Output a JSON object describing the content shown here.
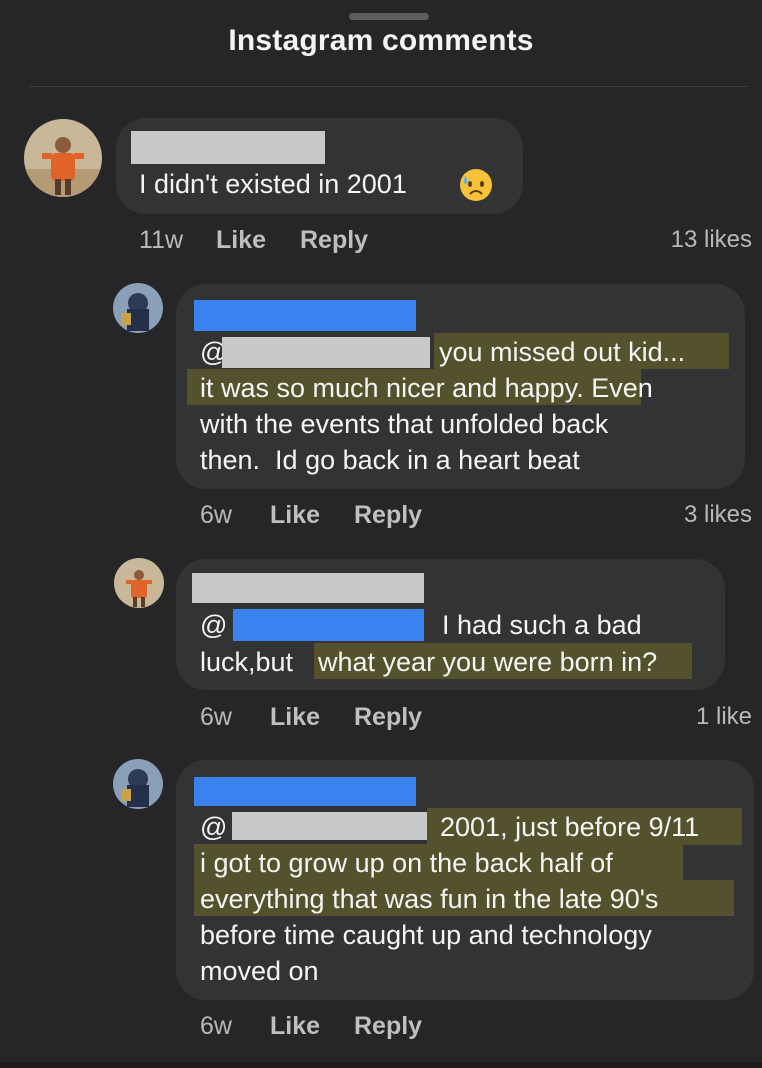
{
  "header": {
    "title": "Instagram comments"
  },
  "comments": [
    {
      "line1": "I didn't existed in 2001",
      "emoji": "sad-sweat-face-icon",
      "time": "11w",
      "like": "Like",
      "reply": "Reply",
      "likes": "13 likes"
    },
    {
      "at": "@",
      "line1": "you missed out kid...",
      "line2a": "it was so much nicer and happy.",
      "line2b": " Even",
      "line3": "with the events that unfolded back",
      "line4": "then.  Id go back in a heart beat",
      "time": "6w",
      "like": "Like",
      "reply": "Reply",
      "likes": "3 likes"
    },
    {
      "at": "@",
      "line1tail": "I had such a bad",
      "line2a": "luck,but ",
      "line2b": "what year you were born in?",
      "time": "6w",
      "like": "Like",
      "reply": "Reply",
      "likes": "1 like"
    },
    {
      "at": "@",
      "line1": "2001, just before 9/11",
      "line2": "i got to grow up on the back half of",
      "line3": "everything that was fun in the late 90's",
      "line4": "before time caught up and technology",
      "line5": "moved on",
      "time": "6w",
      "like": "Like",
      "reply": "Reply"
    }
  ],
  "colors": {
    "background": "#262628",
    "bubble": "#333336",
    "highlight": "#54522c",
    "redact_blue": "#3a82f0",
    "redact_grey": "#c9c9cb"
  }
}
